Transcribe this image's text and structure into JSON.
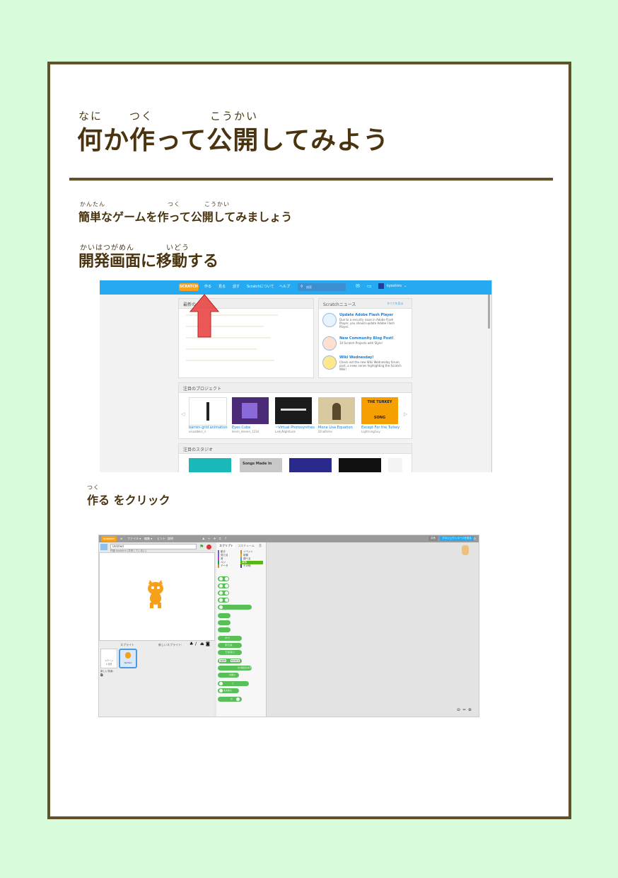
{
  "title": {
    "text": "何か作って公開してみよう",
    "ruby_nani": "なに",
    "ruby_tsuku": "つく",
    "ruby_koukai": "こうかい"
  },
  "intro": {
    "text": "簡単なゲームを作って公開してみましょう",
    "ruby_kantan": "かんたん",
    "ruby_tsuku": "つく",
    "ruby_koukai": "こうかい"
  },
  "section": {
    "text": "開発画面に移動する",
    "ruby_kaihatsu": "かいはつがめん",
    "ruby_idou": "いどう"
  },
  "step": {
    "text": "作る をクリック",
    "ruby_tsuku": "つく"
  },
  "shot1": {
    "logo": "SCRATCH",
    "nav": [
      "作る",
      "見る",
      "話す",
      "Scratchについて",
      "ヘルプ"
    ],
    "search": "検索",
    "user": "kyoshiro",
    "news_title": "Scratchニュース",
    "news_more": "すべてを見る",
    "left_panel_title": "最新の",
    "news": [
      {
        "title": "Update Adobe Flash Player",
        "desc": "Due to a security issue in Adobe Flash Player, you should update Adobe Flash Player."
      },
      {
        "title": "New Community Blog Post!",
        "desc": "10 Scratch Projects with Style!"
      },
      {
        "title": "Wiki Wednesday!",
        "desc": "Check out the new Wiki Wednesday forum post, a news series highlighting the Scratch Wiki!"
      }
    ],
    "featured_title": "注目のプロジェクト",
    "projects": [
      {
        "title": "barren-grid animation",
        "author": "visualbiks_ri"
      },
      {
        "title": "Eyes Cube",
        "author": "kevin_eleven_1234"
      },
      {
        "title": "~Virtual Photosynthes",
        "author": "LadyNightLore"
      },
      {
        "title": "Mona Lisa Equation",
        "author": "DinaParks"
      },
      {
        "title": "Except For the Turkey",
        "author": "LightningGuy"
      }
    ],
    "turkey_line1": "THE TURKEY",
    "turkey_line2": "SONG",
    "studios_title": "注目のスタジオ",
    "studio_label": "Songs Made In"
  },
  "shot2": {
    "logo": "SCRATCH",
    "menu": [
      "ファイル ▾",
      "編集 ▾",
      "ヒント",
      "説明"
    ],
    "save_status": "保存されていません",
    "user": "kyoshiro",
    "project_title": "Untitled",
    "author_line": "作者 kyoshiro (共有していない)",
    "tabs": [
      "スクリプト",
      "コスチューム",
      "音"
    ],
    "share_btn": "共有",
    "project_page_btn": "プロジェクトページを見る",
    "categories": [
      "動き",
      "見た目",
      "音",
      "ペン",
      "データ",
      "イベント",
      "制御",
      "調べる",
      "演算",
      "その他"
    ],
    "sprites_label": "スプライト",
    "new_sprite_label": "新しいスプライト:",
    "stage_label": "ステージ",
    "stage_sub": "1 背景",
    "new_backdrop": "新しい背景:",
    "sprite_name": "Sprite1",
    "blocks": [
      "かつ",
      "または",
      "ではない",
      "apple",
      "banana",
      "と",
      "の長さ",
      "の1番目の文字",
      "を丸める",
      "の"
    ]
  },
  "colors": {
    "frame": "#63512a",
    "background": "#d8fbdc",
    "heading": "#4a3410",
    "nav": "#25aaf1"
  }
}
